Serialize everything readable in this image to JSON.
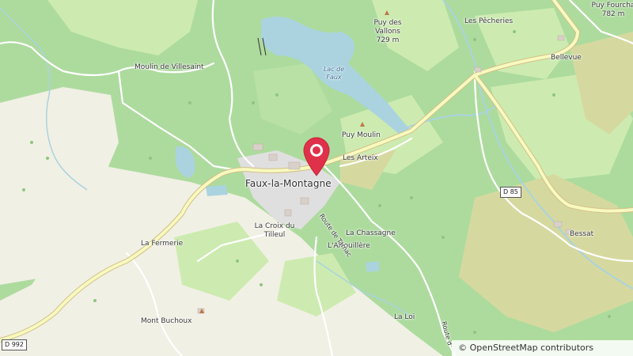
{
  "map": {
    "place_labels": {
      "faux_la_montagne": "Faux-la-Montagne",
      "moulin_de_villesaint": "Moulin de Villesaint",
      "puy_des_vallons": "Puy des\nVallons",
      "puy_des_vallons_elev": "729 m",
      "lac_de_faux": "Lac de\nFaux",
      "puy_moulin": "Puy Moulin",
      "les_arteix": "Les Arteix",
      "les_pecheries": "Les Pêcheries",
      "bellevue": "Bellevue",
      "puy_fourcha": "Puy Fourcha",
      "puy_fourcha_elev": "782 m",
      "la_croix_du_tilleul": "La Croix du\nTilleul",
      "la_chassagne": "La Chassagne",
      "larfouillere": "L'Arfouillère",
      "la_fermerie": "La Fermerie",
      "bessat": "Bessat",
      "mont_buchoux": "Mont Buchoux",
      "la_loi": "La Loi"
    },
    "road_labels": {
      "route_de_tarnac": "Route de Tarnac",
      "route_de_partial": "Route d"
    },
    "road_shields": {
      "d85": "D 85",
      "d992": "D 992"
    },
    "attribution": "© OpenStreetMap contributors",
    "marker": {
      "name": "location-marker"
    },
    "colors": {
      "forest": "#addb9e",
      "meadow": "#cdebb0",
      "farmland": "#f1f0e5",
      "heath": "#d6d99f",
      "water": "#aad3df",
      "major_road": "#f7fabf",
      "marker": "#e0314a"
    }
  }
}
